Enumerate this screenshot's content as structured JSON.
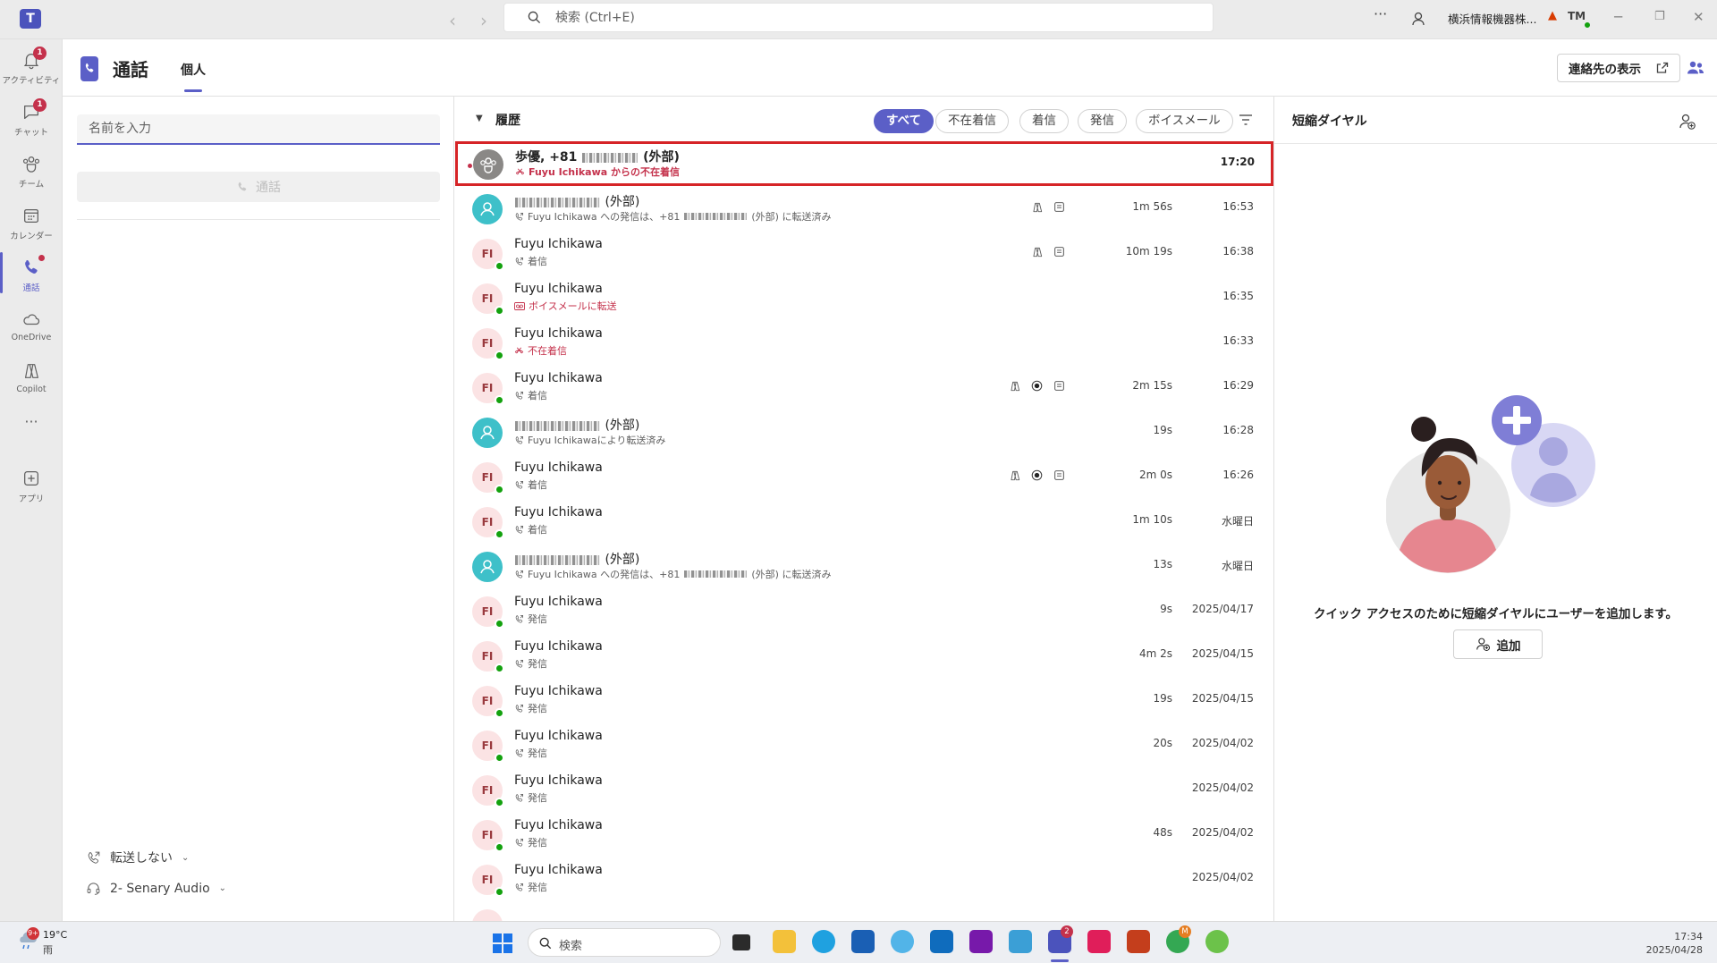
{
  "titlebar": {
    "search_placeholder": "検索 (Ctrl+E)",
    "more": "···",
    "tenant": "横浜情報機器株...",
    "warning": "▲",
    "initials": "TM"
  },
  "rail": {
    "items": [
      {
        "label": "アクティビティ",
        "badge": "1"
      },
      {
        "label": "チャット",
        "badge": "1"
      },
      {
        "label": "チーム"
      },
      {
        "label": "カレンダー"
      },
      {
        "label": "通話"
      },
      {
        "label": "OneDrive"
      },
      {
        "label": "Copilot"
      },
      {
        "label": "アプリ"
      }
    ],
    "more": "···"
  },
  "header": {
    "title": "通話",
    "tab": "個人",
    "contacts_button": "連絡先の表示"
  },
  "dialer": {
    "name_placeholder": "名前を入力",
    "call_button": "通話",
    "forwarding": "転送しない",
    "audio_device": "2- Senary Audio"
  },
  "history": {
    "title": "履歴",
    "filters": [
      "すべて",
      "不在着信",
      "着信",
      "発信",
      "ボイスメール"
    ],
    "rows": [
      {
        "name_prefix": "歩優, +81",
        "name_suffix": "(外部)",
        "sub": "Fuyu Ichikawa からの不在着信",
        "duration": "",
        "time": "17:20"
      },
      {
        "name_suffix": "(外部)",
        "sub_pre": "Fuyu Ichikawa への発信は、+81",
        "sub_post": "(外部) に転送済み",
        "duration": "1m 56s",
        "time": "16:53"
      },
      {
        "name": "Fuyu Ichikawa",
        "initials": "FI",
        "sub": "着信",
        "duration": "10m 19s",
        "time": "16:38"
      },
      {
        "name": "Fuyu Ichikawa",
        "initials": "FI",
        "sub": "ボイスメールに転送",
        "duration": "",
        "time": "16:35"
      },
      {
        "name": "Fuyu Ichikawa",
        "initials": "FI",
        "sub": "不在着信",
        "duration": "",
        "time": "16:33"
      },
      {
        "name": "Fuyu Ichikawa",
        "initials": "FI",
        "sub": "着信",
        "duration": "2m 15s",
        "time": "16:29"
      },
      {
        "name_suffix": "(外部)",
        "sub": "Fuyu Ichikawaにより転送済み",
        "duration": "19s",
        "time": "16:28"
      },
      {
        "name": "Fuyu Ichikawa",
        "initials": "FI",
        "sub": "着信",
        "duration": "2m 0s",
        "time": "16:26"
      },
      {
        "name": "Fuyu Ichikawa",
        "initials": "FI",
        "sub": "着信",
        "duration": "1m 10s",
        "time": "水曜日"
      },
      {
        "name_suffix": "(外部)",
        "sub_pre": "Fuyu Ichikawa への発信は、+81",
        "sub_post": "(外部) に転送済み",
        "duration": "13s",
        "time": "水曜日"
      },
      {
        "name": "Fuyu Ichikawa",
        "initials": "FI",
        "sub": "発信",
        "duration": "9s",
        "time": "2025/04/17"
      },
      {
        "name": "Fuyu Ichikawa",
        "initials": "FI",
        "sub": "発信",
        "duration": "4m 2s",
        "time": "2025/04/15"
      },
      {
        "name": "Fuyu Ichikawa",
        "initials": "FI",
        "sub": "発信",
        "duration": "19s",
        "time": "2025/04/15"
      },
      {
        "name": "Fuyu Ichikawa",
        "initials": "FI",
        "sub": "発信",
        "duration": "20s",
        "time": "2025/04/02"
      },
      {
        "name": "Fuyu Ichikawa",
        "initials": "FI",
        "sub": "発信",
        "duration": "",
        "time": "2025/04/02"
      },
      {
        "name": "Fuyu Ichikawa",
        "initials": "FI",
        "sub": "発信",
        "duration": "48s",
        "time": "2025/04/02"
      },
      {
        "name": "Fuyu Ichikawa",
        "initials": "FI",
        "sub": "発信",
        "duration": "",
        "time": "2025/04/02"
      }
    ]
  },
  "speed_dial": {
    "title": "短縮ダイヤル",
    "message": "クイック アクセスのために短縮ダイヤルにユーザーを追加します。",
    "add_button": "追加"
  },
  "taskbar": {
    "weather_badge": "9+",
    "temperature": "19°C",
    "condition": "雨",
    "search": "検索",
    "teams_badge": "2",
    "chrome_badge": "M",
    "time": "17:34",
    "date": "2025/04/28"
  },
  "colors": {
    "accent": "#5b5fc7",
    "missed": "#c4314b",
    "selection_border": "#d62427",
    "presence": "#13a10e",
    "avatar_fi_bg": "#fbe3e4",
    "avatar_fi_fg": "#9a3b3f",
    "avatar_ext_bg": "#3ec0c9"
  }
}
